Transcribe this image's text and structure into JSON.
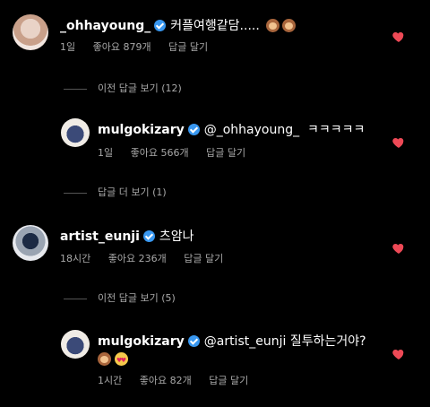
{
  "comments": [
    {
      "username": "_ohhayoung_",
      "text": "커플여행같담.....",
      "time": "1일",
      "likes": "좋아요 879개",
      "reply": "답글 달기"
    },
    {
      "thread_toggle": "이전 답글 보기 (12)"
    },
    {
      "username": "mulgokizary",
      "mention": "@_ohhayoung_",
      "text": "ㅋㅋㅋㅋㅋ",
      "time": "1일",
      "likes": "좋아요 566개",
      "reply": "답글 달기"
    },
    {
      "thread_toggle": "답글 더 보기 (1)"
    },
    {
      "username": "artist_eunji",
      "text": "츠암나",
      "time": "18시간",
      "likes": "좋아요 236개",
      "reply": "답글 달기"
    },
    {
      "thread_toggle": "이전 답글 보기 (5)"
    },
    {
      "username": "mulgokizary",
      "mention": "@artist_eunji",
      "text": "질투하는거야?",
      "time": "1시간",
      "likes": "좋아요 82개",
      "reply": "답글 달기"
    }
  ],
  "icons": {
    "verified": "verified-badge-icon",
    "like": "heart-icon",
    "emoji_monkey": "see-no-evil-monkey-icon",
    "emoji_heart_eyes": "heart-eyes-icon"
  },
  "colors": {
    "background": "#000000",
    "heart": "#ed4956",
    "verified": "#3897f0",
    "meta": "#a8a8a8"
  }
}
